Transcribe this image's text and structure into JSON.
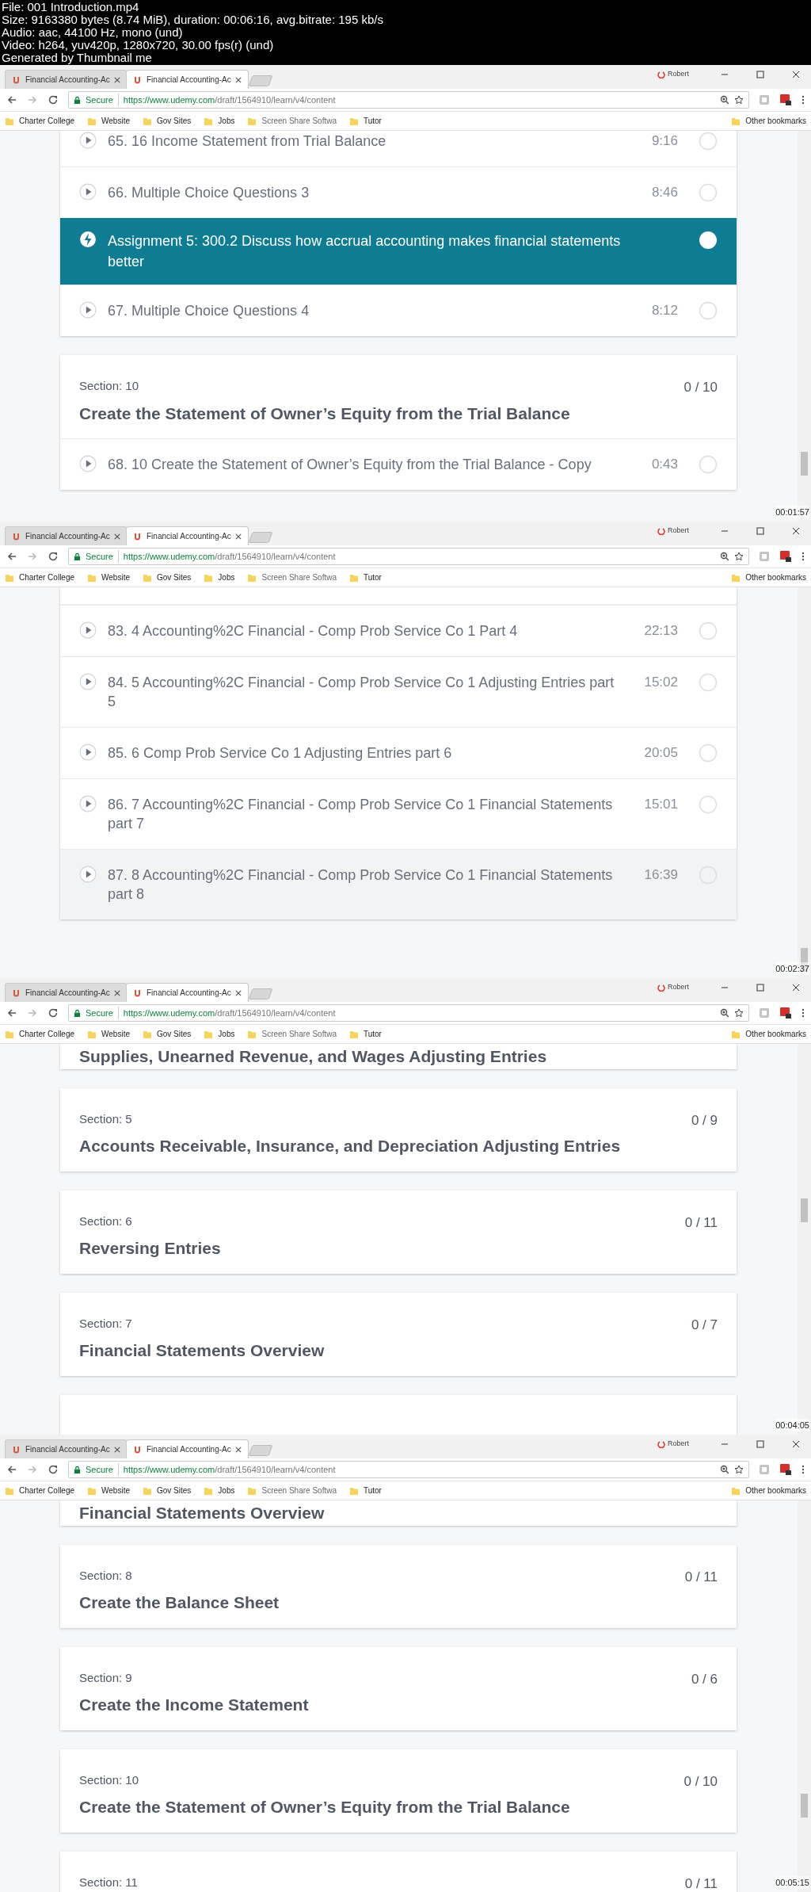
{
  "file_info": [
    "File: 001 Introduction.mp4",
    "Size: 9163380 bytes (8.74 MiB), duration: 00:06:16, avg.bitrate: 195 kb/s",
    "Audio: aac, 44100 Hz, mono (und)",
    "Video: h264, yuv420p, 1280x720, 30.00 fps(r) (und)",
    "Generated by Thumbnail me"
  ],
  "frames": [
    {
      "timestamp": "00:01:57",
      "profile": "Robert",
      "tabs": [
        {
          "label": "Financial Accounting-Ac",
          "selected": false
        },
        {
          "label": "Financial Accounting-Ac",
          "selected": true
        }
      ],
      "secure": "Secure",
      "url_host": "https://www.udemy.com",
      "url_path": "/draft/1564910/learn/v4/content",
      "bookmarks": [
        "Charter College",
        "Website",
        "Gov Sites",
        "Jobs",
        "Screen Share Softwa",
        "Tutor"
      ],
      "other_bookmarks": "Other bookmarks",
      "cards": [
        {
          "kind": "list",
          "rows": [
            {
              "kind": "lecture",
              "title": "65.  16 Income Statement from Trial Balance",
              "duration": "9:16",
              "highlighted": false
            },
            {
              "kind": "lecture",
              "title": "66.  Multiple Choice Questions 3",
              "duration": "8:46",
              "highlighted": false
            },
            {
              "kind": "assignment",
              "title": "Assignment 5:  300.2 Discuss how accrual accounting makes financial statements better"
            },
            {
              "kind": "lecture",
              "title": "67.  Multiple Choice Questions 4",
              "duration": "8:12",
              "highlighted": false
            }
          ]
        },
        {
          "kind": "section",
          "label": "Section: 10",
          "progress": "0 / 10",
          "title": "Create the Statement of Owner’s Equity from the Trial Balance",
          "rows": [
            {
              "kind": "lecture",
              "title": "68.  10 Create the Statement of Owner’s Equity from the Trial Balance - Copy",
              "duration": "0:43",
              "highlighted": false
            }
          ]
        }
      ]
    },
    {
      "timestamp": "00:02:37",
      "profile": "Robert",
      "tabs": [
        {
          "label": "Financial Accounting-Ac",
          "selected": false
        },
        {
          "label": "Financial Accounting-Ac",
          "selected": true
        }
      ],
      "secure": "Secure",
      "url_host": "https://www.udemy.com",
      "url_path": "/draft/1564910/learn/v4/content",
      "bookmarks": [
        "Charter College",
        "Website",
        "Gov Sites",
        "Jobs",
        "Screen Share Softwa",
        "Tutor"
      ],
      "other_bookmarks": "Other bookmarks",
      "cards": [
        {
          "kind": "list",
          "rows": [
            {
              "kind": "lecture",
              "title": "83.  4 Accounting%2C Financial - Comp Prob Service Co 1 Part 4",
              "duration": "22:13",
              "highlighted": false
            },
            {
              "kind": "lecture",
              "title": "84.  5 Accounting%2C Financial - Comp Prob Service Co 1 Adjusting Entries part 5",
              "duration": "15:02",
              "highlighted": false
            },
            {
              "kind": "lecture",
              "title": "85.  6 Comp Prob Service Co 1 Adjusting Entries part 6",
              "duration": "20:05",
              "highlighted": false
            },
            {
              "kind": "lecture",
              "title": "86.  7 Accounting%2C Financial - Comp Prob Service Co 1 Financial Statements part 7",
              "duration": "15:01",
              "highlighted": false
            },
            {
              "kind": "lecture",
              "title": "87.  8 Accounting%2C Financial - Comp Prob Service Co 1 Financial Statements part 8",
              "duration": "16:39",
              "highlighted": true
            }
          ]
        }
      ]
    },
    {
      "timestamp": "00:04:05",
      "profile": "Robert",
      "tabs": [
        {
          "label": "Financial Accounting-Ac",
          "selected": false
        },
        {
          "label": "Financial Accounting-Ac",
          "selected": true
        }
      ],
      "secure": "Secure",
      "url_host": "https://www.udemy.com",
      "url_path": "/draft/1564910/learn/v4/content",
      "bookmarks": [
        "Charter College",
        "Website",
        "Gov Sites",
        "Jobs",
        "Screen Share Softwa",
        "Tutor"
      ],
      "other_bookmarks": "Other bookmarks",
      "cards": [
        {
          "kind": "tail",
          "title": "Supplies, Unearned Revenue, and Wages Adjusting Entries"
        },
        {
          "kind": "section",
          "label": "Section: 5",
          "progress": "0 / 9",
          "title": "Accounts Receivable, Insurance, and Depreciation Adjusting Entries"
        },
        {
          "kind": "section",
          "label": "Section: 6",
          "progress": "0 / 11",
          "title": "Reversing Entries"
        },
        {
          "kind": "section",
          "label": "Section: 7",
          "progress": "0 / 7",
          "title": "Financial Statements Overview"
        },
        {
          "kind": "empty"
        }
      ]
    },
    {
      "timestamp": "00:05:15",
      "profile": "Robert",
      "tabs": [
        {
          "label": "Financial Accounting-Ac",
          "selected": false
        },
        {
          "label": "Financial Accounting-Ac",
          "selected": true
        }
      ],
      "secure": "Secure",
      "url_host": "https://www.udemy.com",
      "url_path": "/draft/1564910/learn/v4/content",
      "bookmarks": [
        "Charter College",
        "Website",
        "Gov Sites",
        "Jobs",
        "Screen Share Softwa",
        "Tutor"
      ],
      "other_bookmarks": "Other bookmarks",
      "cards": [
        {
          "kind": "tail",
          "title": "Financial Statements Overview"
        },
        {
          "kind": "section",
          "label": "Section: 8",
          "progress": "0 / 11",
          "title": "Create the Balance Sheet"
        },
        {
          "kind": "section",
          "label": "Section: 9",
          "progress": "0 / 6",
          "title": "Create the Income Statement"
        },
        {
          "kind": "section",
          "label": "Section: 10",
          "progress": "0 / 10",
          "title": "Create the Statement of Owner’s Equity from the Trial Balance"
        },
        {
          "kind": "section",
          "label": "Section: 11",
          "progress": "0 / 11"
        }
      ]
    }
  ]
}
